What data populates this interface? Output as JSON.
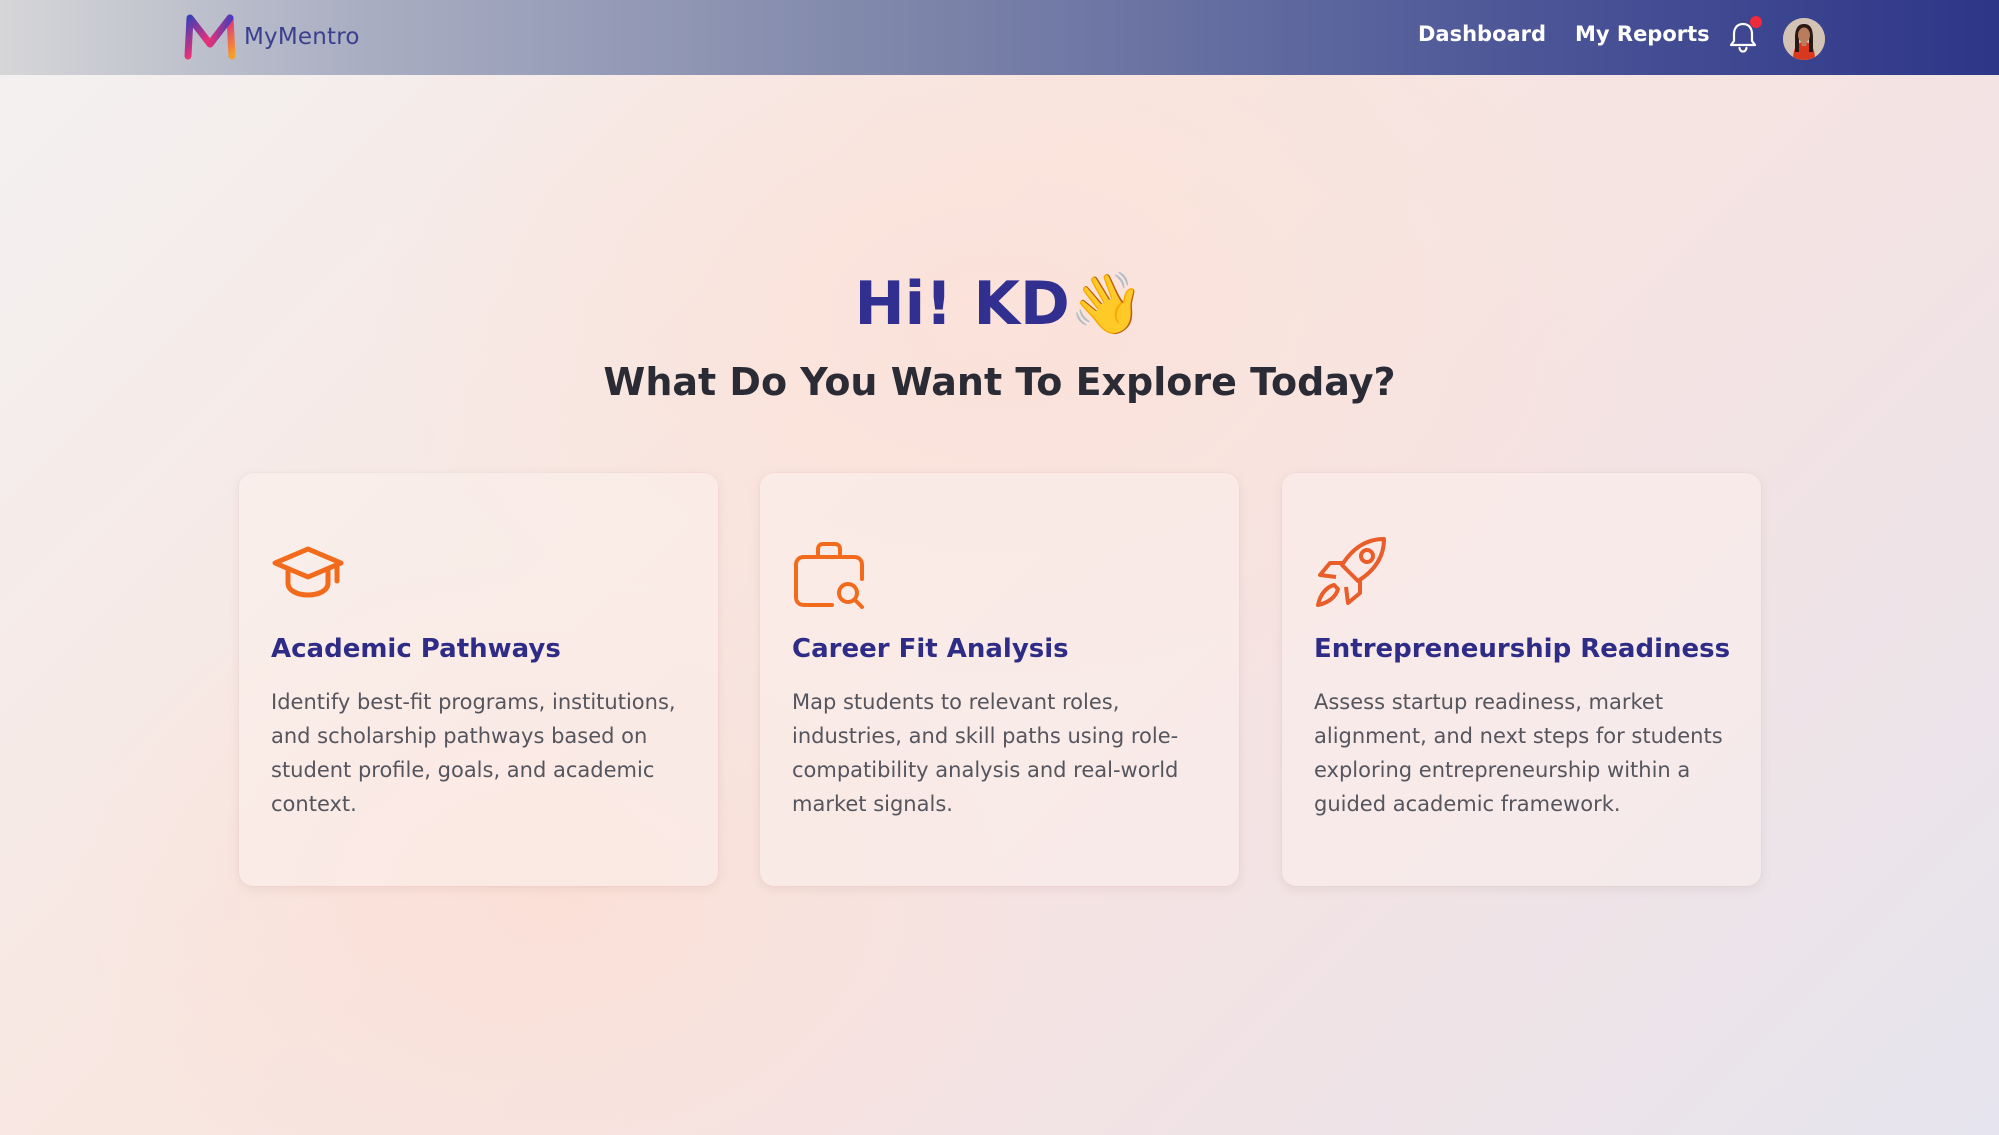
{
  "app": {
    "name": "MyMentro"
  },
  "nav": {
    "links": [
      "Dashboard",
      "My Reports"
    ],
    "icons": [
      "bell-icon",
      "avatar"
    ],
    "has_notification": true
  },
  "hero": {
    "greeting": "Hi! KD",
    "emoji": "👋",
    "subheading": "What Do You Want To Explore Today?"
  },
  "cards": [
    {
      "icon": "graduation-cap-icon",
      "title": "Academic Pathways",
      "description": "Identify best-fit programs, institutions, and scholarship pathways based on student profile, goals, and academic context."
    },
    {
      "icon": "briefcase-search-icon",
      "title": "Career Fit Analysis",
      "description": "Map students to relevant roles, industries, and skill paths using role-compatibility analysis and real-world market signals."
    },
    {
      "icon": "rocket-icon",
      "title": "Entrepreneurship Readiness",
      "description": "Assess startup readiness, market alignment, and next steps for students exploring entrepreneurship within a guided academic framework."
    }
  ],
  "colors": {
    "accent": "#312f8f",
    "icon": "#f26a1b",
    "notification": "#ef2a3b"
  }
}
